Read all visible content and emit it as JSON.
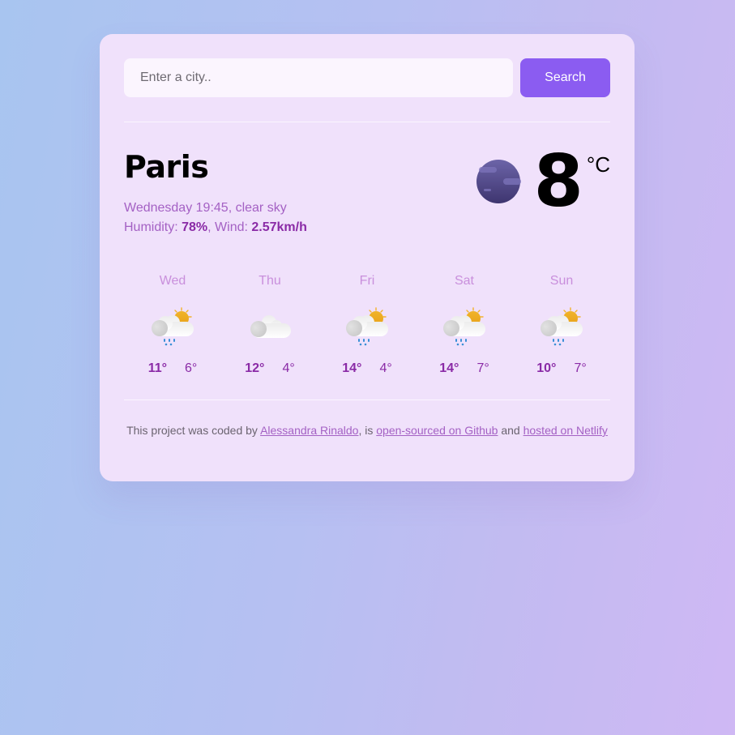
{
  "search": {
    "placeholder": "Enter a city..",
    "value": "",
    "button_label": "Search"
  },
  "current": {
    "city": "Paris",
    "day_time": "Wednesday 19:45",
    "description": "clear sky",
    "humidity_label": "Humidity: ",
    "humidity": "78%",
    "wind_label": "Wind: ",
    "wind": "2.57km/h",
    "icon": "clear-sky-night-icon",
    "temperature": "8",
    "unit": "°C"
  },
  "forecast": [
    {
      "day": "Wed",
      "icon": "sun-cloud-rain-icon",
      "max": "11°",
      "min": "6°"
    },
    {
      "day": "Thu",
      "icon": "cloud-icon",
      "max": "12°",
      "min": "4°"
    },
    {
      "day": "Fri",
      "icon": "sun-cloud-rain-icon",
      "max": "14°",
      "min": "4°"
    },
    {
      "day": "Sat",
      "icon": "sun-cloud-rain-icon",
      "max": "14°",
      "min": "7°"
    },
    {
      "day": "Sun",
      "icon": "sun-cloud-rain-icon",
      "max": "10°",
      "min": "7°"
    }
  ],
  "footer": {
    "text1": "This project was coded by ",
    "author_link": "Alessandra Rinaldo",
    "text2": ", is ",
    "github_link": "open-sourced on Github",
    "text3": " and ",
    "netlify_link": "hosted on Netlify"
  },
  "colors": {
    "accent": "#8b5cf1",
    "card_bg": "#f0e1fb",
    "detail_text": "#a461c4",
    "emphasis": "#8a2aa6"
  }
}
